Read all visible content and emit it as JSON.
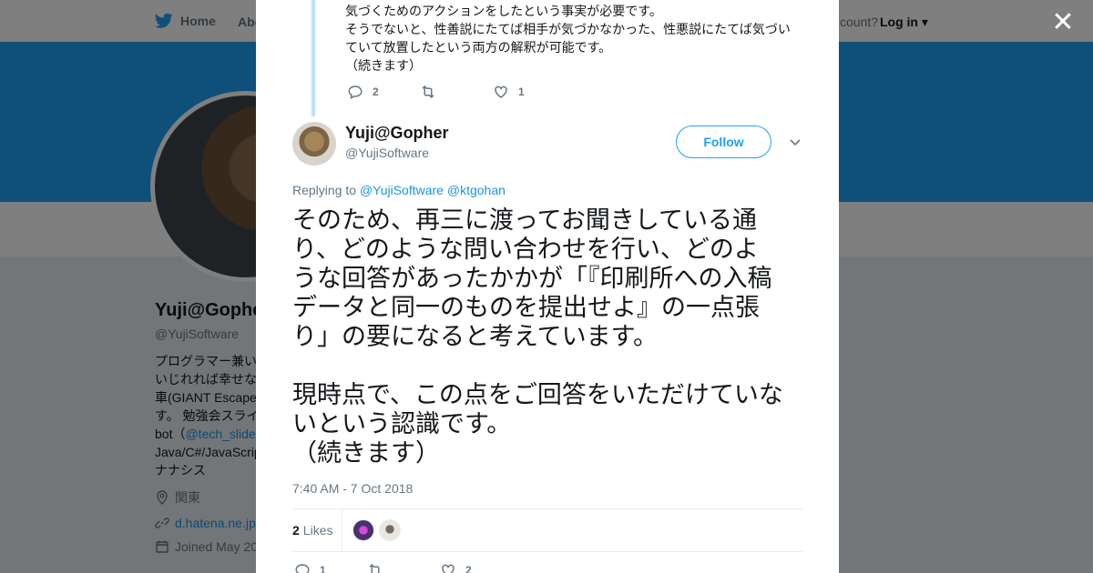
{
  "nav": {
    "home": "Home",
    "about": "Abo",
    "account_prompt": "ccount?",
    "login": "Log in"
  },
  "profile": {
    "name": "Yuji@Gopher",
    "handle": "@YujiSoftware",
    "bio": "プログラマー兼い\nいじれれば幸せな\n車(GIANT Escape\nす。 勉強会スライ\nbot（",
    "bio_link": "@tech_slide",
    "bio_tail": "Java/C#/JavaScrip\nナナシス",
    "location": "関東",
    "website": "d.hatena.ne.jp",
    "joined": "Joined May 20"
  },
  "modal": {
    "prev_tweet": {
      "text": "気づくためのアクションをしたという事実が必要です。\nそうでないと、性善説にたてば相手が気づかなかった、性悪説にたてば気づい\nていて放置したという両方の解釈が可能です。\n（続きます）",
      "replies": "2",
      "retweets": "",
      "likes": "1"
    },
    "tweet": {
      "author_name": "Yuji@Gopher",
      "author_handle": "@YujiSoftware",
      "follow_label": "Follow",
      "replying_prefix": "Replying to",
      "replying_to": [
        "@YujiSoftware",
        "@ktgohan"
      ],
      "text": "そのため、再三に渡ってお聞きしている通\nり、どのような問い合わせを行い、どのよ\nうな回答があったかかが「『印刷所への入稿\nデータと同一のものを提出せよ』の一点張\nり」の要になると考えています。\n\n現時点で、この点をご回答をいただけていな\nいという認識です。\n（続きます）",
      "timestamp": "7:40 AM - 7 Oct 2018",
      "likes_count": "2",
      "likes_label": "Likes",
      "replies": "1",
      "retweets": "",
      "likes": "2"
    }
  },
  "colors": {
    "accent": "#1da1f2",
    "banner": "#1da1f2",
    "link": "#1b95e0",
    "muted": "#657786",
    "thread_line": "#bde1f9"
  },
  "icons": [
    "twitter-bird-icon",
    "close-icon",
    "reply-icon",
    "retweet-icon",
    "heart-icon",
    "chevron-down-icon",
    "location-icon",
    "link-icon",
    "calendar-icon"
  ]
}
